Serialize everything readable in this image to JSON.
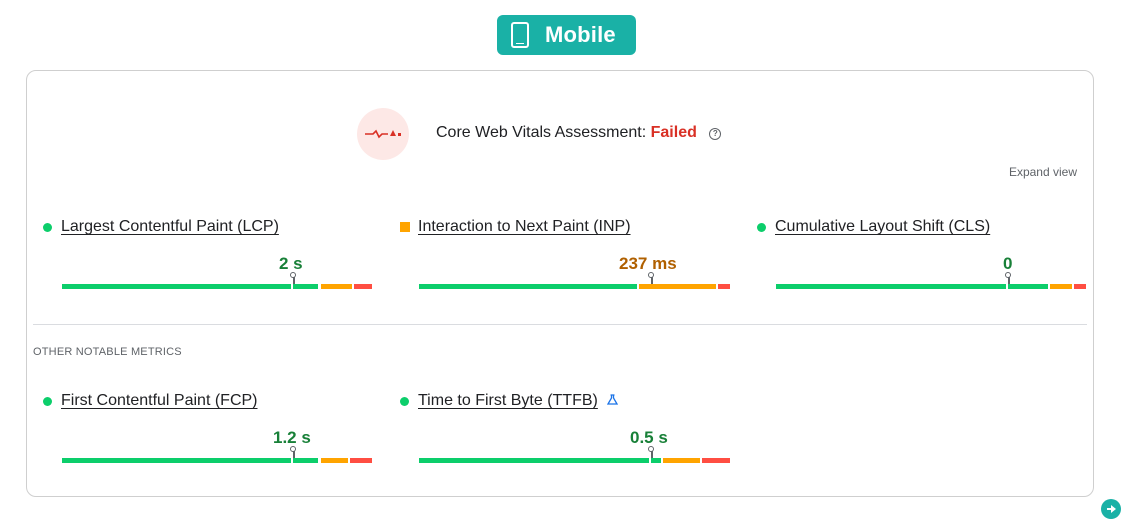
{
  "device_badge": {
    "label": "Mobile",
    "icon": "phone-icon"
  },
  "assessment": {
    "title": "Core Web Vitals Assessment:",
    "status": "Failed",
    "status_color": "#d93025",
    "icon": "vitals-pulse-icon",
    "help": "?"
  },
  "expand_view": "Expand view",
  "other_heading": "OTHER NOTABLE METRICS",
  "colors": {
    "good": "#0cce6b",
    "needs_improvement": "#ffa400",
    "poor": "#ff4e42",
    "accent": "#1ab1a6"
  },
  "core_metrics": [
    {
      "name": "Largest Contentful Paint (LCP)",
      "value": "2 s",
      "rating": "good",
      "marker_fraction": 0.75
    },
    {
      "name": "Interaction to Next Paint (INP)",
      "value": "237 ms",
      "rating": "needs-improvement",
      "marker_fraction": 0.75
    },
    {
      "name": "Cumulative Layout Shift (CLS)",
      "value": "0",
      "rating": "good",
      "marker_fraction": 0.75
    }
  ],
  "other_metrics": [
    {
      "name": "First Contentful Paint (FCP)",
      "value": "1.2 s",
      "rating": "good",
      "marker_fraction": 0.75
    },
    {
      "name": "Time to First Byte (TTFB)",
      "value": "0.5 s",
      "rating": "good",
      "marker_fraction": 0.75,
      "experimental_icon": "flask-icon"
    }
  ]
}
